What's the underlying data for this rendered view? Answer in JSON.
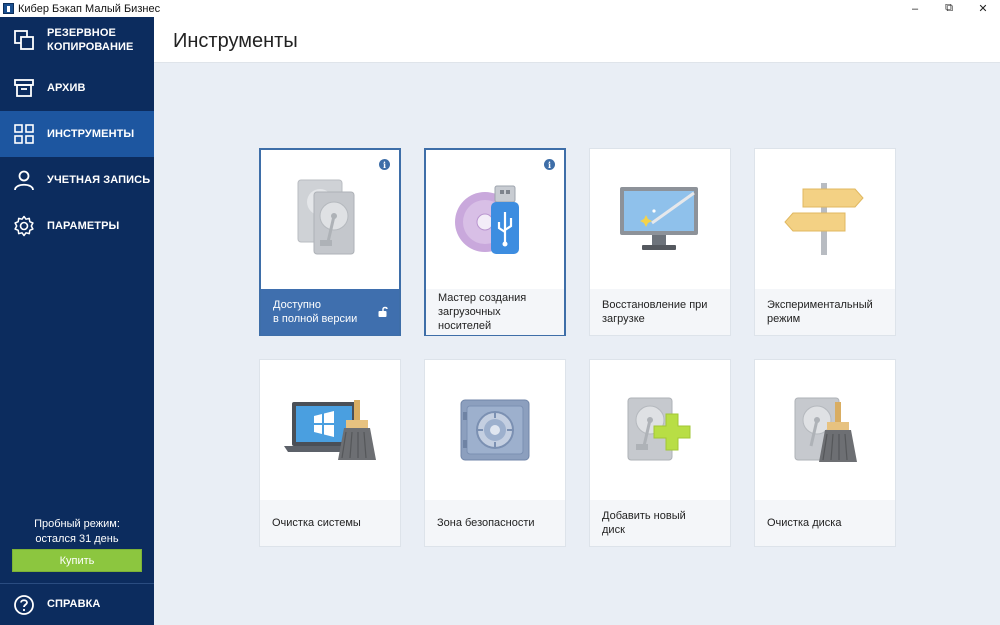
{
  "window": {
    "title": "Кибер Бэкап Малый Бизнес",
    "minimize": "–",
    "maximize": "⧉",
    "close": "✕"
  },
  "sidebar": {
    "items": [
      {
        "label": "РЕЗЕРВНОЕ КОПИРОВАНИЕ",
        "icon": "backup-icon"
      },
      {
        "label": "АРХИВ",
        "icon": "archive-icon"
      },
      {
        "label": "ИНСТРУМЕНТЫ",
        "icon": "tools-icon",
        "active": true
      },
      {
        "label": "УЧЕТНАЯ ЗАПИСЬ",
        "icon": "account-icon"
      },
      {
        "label": "ПАРАМЕТРЫ",
        "icon": "gear-icon"
      }
    ],
    "trial_line1": "Пробный режим:",
    "trial_line2": "остался 31 день",
    "buy_label": "Купить",
    "help_label": "СПРАВКА"
  },
  "header": {
    "title": "Инструменты"
  },
  "tiles": [
    {
      "label": "Доступно в полной версии",
      "line1": "Доступно",
      "line2": "в полной версии",
      "icon": "two-hdd-icon",
      "info": "i"
    },
    {
      "label": "Мастер создания загрузочных носителей",
      "line1": "Мастер создания",
      "line2": "загрузочных носителей",
      "icon": "usb-disc-icon",
      "info": "i"
    },
    {
      "label": "Восстановление при загрузке",
      "line1": "Восстановление при",
      "line2": "загрузке",
      "icon": "monitor-wand-icon"
    },
    {
      "label": "Экспериментальный режим",
      "line1": "Экспериментальный",
      "line2": "режим",
      "icon": "signpost-icon"
    },
    {
      "label": "Очистка системы",
      "icon": "laptop-broom-icon"
    },
    {
      "label": "Зона безопасности",
      "icon": "safe-icon"
    },
    {
      "label": "Добавить новый диск",
      "icon": "hdd-plus-icon"
    },
    {
      "label": "Очистка диска",
      "icon": "hdd-broom-icon"
    }
  ],
  "colors": {
    "sidebar": "#0c2c5e",
    "active": "#1d56a0",
    "accent": "#3f6fae",
    "buy": "#8cc63f"
  }
}
